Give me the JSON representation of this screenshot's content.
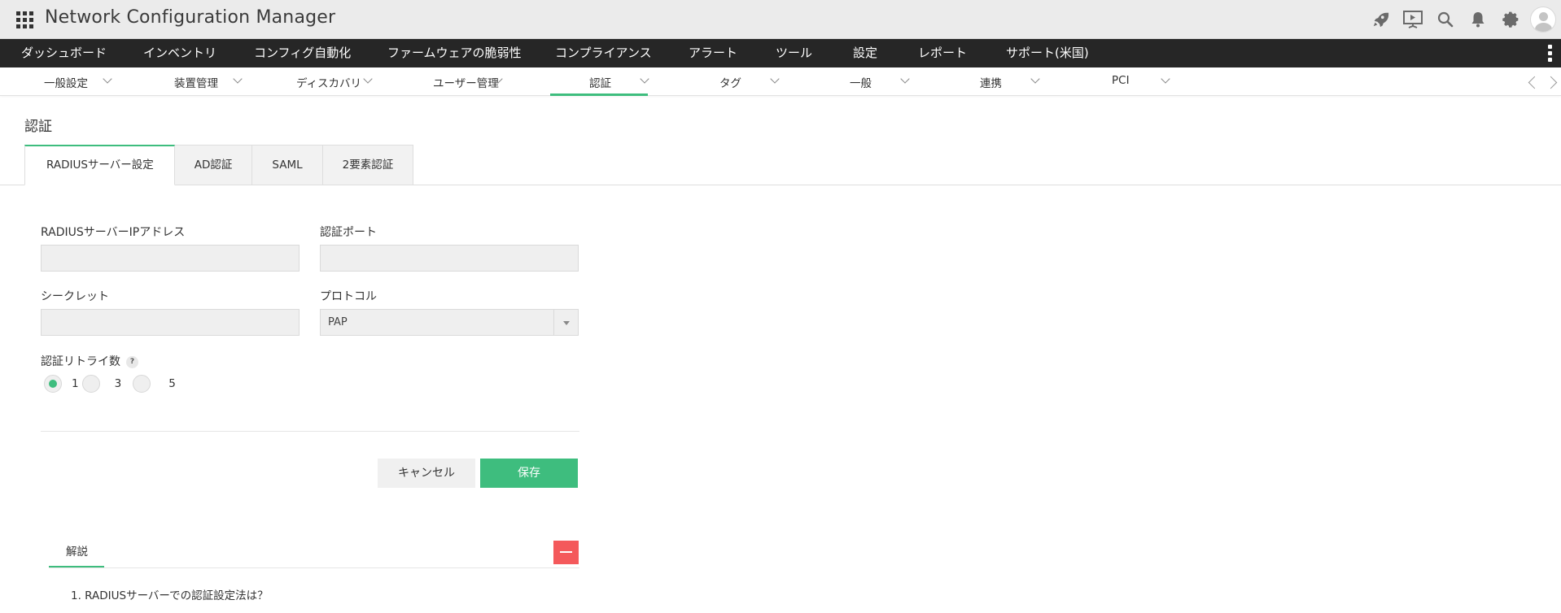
{
  "app": {
    "title": "Network Configuration Manager"
  },
  "top_icons": [
    "rocket-icon",
    "presentation-icon",
    "search-icon",
    "bell-icon",
    "gear-icon",
    "user-avatar"
  ],
  "main_nav": {
    "items": [
      "ダッシュボード",
      "インベントリ",
      "コンフィグ自動化",
      "ファームウェアの脆弱性",
      "コンプライアンス",
      "アラート",
      "ツール",
      "設定",
      "レポート",
      "サポート(米国)"
    ]
  },
  "sub_nav": {
    "items": [
      "一般設定",
      "装置管理",
      "ディスカバリ",
      "ユーザー管理",
      "認証",
      "タグ",
      "一般",
      "連携",
      "PCI"
    ],
    "active": "認証"
  },
  "page": {
    "title": "認証"
  },
  "tabs": {
    "items": [
      "RADIUSサーバー設定",
      "AD認証",
      "SAML",
      "2要素認証"
    ],
    "active": "RADIUSサーバー設定"
  },
  "form": {
    "server_ip_label": "RADIUSサーバーIPアドレス",
    "server_ip_value": "",
    "port_label": "認証ポート",
    "port_value": "",
    "secret_label": "シークレット",
    "secret_value": "",
    "protocol_label": "プロトコル",
    "protocol_value": "PAP",
    "retry_label": "認証リトライ数",
    "retry_help": "?",
    "retry_options": [
      "1",
      "3",
      "5"
    ],
    "retry_selected": "1"
  },
  "buttons": {
    "cancel": "キャンセル",
    "save": "保存"
  },
  "explanation": {
    "tab_label": "解説",
    "items": [
      "1. RADIUSサーバーでの認証設定法は？"
    ]
  },
  "colors": {
    "accent": "#3ebd7e",
    "nav_bg": "#262626",
    "titlebar_bg": "#ebebeb",
    "collapse_button": "#f4595b"
  }
}
